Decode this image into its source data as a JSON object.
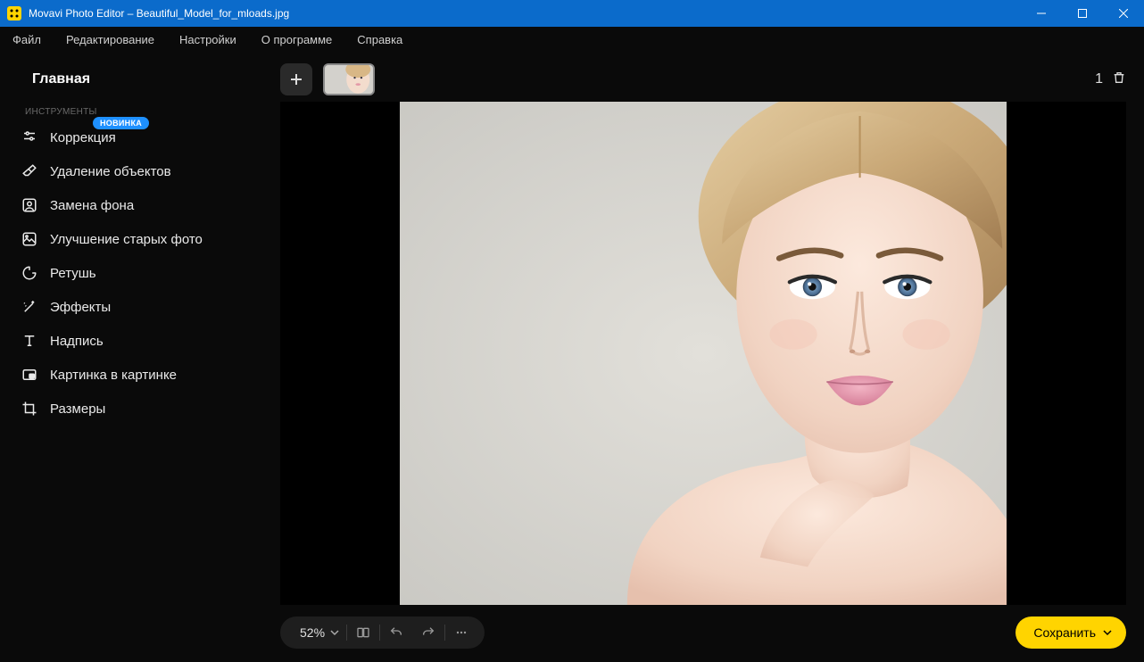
{
  "window": {
    "title": "Movavi Photo Editor – Beautiful_Model_for_mloads.jpg"
  },
  "menu": {
    "file": "Файл",
    "edit": "Редактирование",
    "settings": "Настройки",
    "about": "О программе",
    "help": "Справка"
  },
  "sidebar": {
    "home": "Главная",
    "section_tools": "ИНСТРУМЕНТЫ",
    "badge_new": "НОВИНКА",
    "items": {
      "correction": "Коррекция",
      "object_removal": "Удаление объектов",
      "bg_replace": "Замена фона",
      "old_photo": "Улучшение старых фото",
      "retouch": "Ретушь",
      "effects": "Эффекты",
      "caption": "Надпись",
      "pip": "Картинка в картинке",
      "sizes": "Размеры"
    }
  },
  "thumbs": {
    "count": "1"
  },
  "bottom": {
    "zoom": "52%",
    "save": "Сохранить"
  }
}
